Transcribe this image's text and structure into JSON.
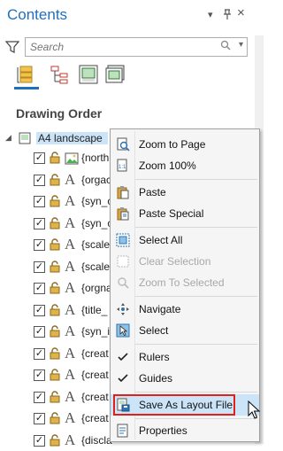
{
  "pane": {
    "title": "Contents",
    "dropdown_glyph": "▾",
    "pin_glyph": "ᵖ",
    "close_glyph": "×"
  },
  "search": {
    "placeholder": "Search",
    "dropdown_glyph": "▾",
    "search_glyph": "⌕"
  },
  "section": {
    "title": "Drawing Order"
  },
  "frame": {
    "expand_glyph": "◢",
    "label": "A4 landscape"
  },
  "layers": [
    {
      "label": "{north",
      "icon": "picture-icon",
      "checked": "✓",
      "glyph": ""
    },
    {
      "label": "{orgac",
      "icon": "text-element-icon",
      "checked": "✓",
      "glyph": "A"
    },
    {
      "label": "{syn_c",
      "icon": "text-element-icon",
      "checked": "✓",
      "glyph": "A"
    },
    {
      "label": "{syn_c",
      "icon": "text-element-icon",
      "checked": "✓",
      "glyph": "A"
    },
    {
      "label": "{scale",
      "icon": "text-element-icon",
      "checked": "✓",
      "glyph": "A"
    },
    {
      "label": "{scale",
      "icon": "text-element-icon",
      "checked": "✓",
      "glyph": "A"
    },
    {
      "label": "{orgna",
      "icon": "text-element-icon",
      "checked": "✓",
      "glyph": "A"
    },
    {
      "label": "{title_",
      "icon": "text-element-icon",
      "checked": "✓",
      "glyph": "A"
    },
    {
      "label": "{syn_i",
      "icon": "text-element-icon",
      "checked": "✓",
      "glyph": "A"
    },
    {
      "label": "{creat",
      "icon": "text-element-icon",
      "checked": "✓",
      "glyph": "A"
    },
    {
      "label": "{creat",
      "icon": "text-element-icon",
      "checked": "✓",
      "glyph": "A"
    },
    {
      "label": "{creat",
      "icon": "text-element-icon",
      "checked": "✓",
      "glyph": "A"
    },
    {
      "label": "{creat",
      "icon": "text-element-icon",
      "checked": "✓",
      "glyph": "A"
    },
    {
      "label": "{discla",
      "icon": "text-element-icon",
      "checked": "✓",
      "glyph": "A"
    }
  ],
  "context_menu": {
    "items": [
      {
        "label": "Zoom to Page",
        "icon": "zoom-page-icon",
        "enabled": true
      },
      {
        "label": "Zoom 100%",
        "icon": "zoom-100-icon",
        "enabled": true
      },
      {
        "label": "Paste",
        "icon": "paste-icon",
        "enabled": true
      },
      {
        "label": "Paste Special",
        "icon": "paste-special-icon",
        "enabled": true
      },
      {
        "label": "Select All",
        "icon": "select-all-icon",
        "enabled": true
      },
      {
        "label": "Clear Selection",
        "icon": "clear-selection-icon",
        "enabled": false
      },
      {
        "label": "Zoom To Selected",
        "icon": "zoom-selected-icon",
        "enabled": false
      },
      {
        "label": "Navigate",
        "icon": "navigate-icon",
        "enabled": true
      },
      {
        "label": "Select",
        "icon": "select-arrow-icon",
        "enabled": true
      },
      {
        "label": "Rulers",
        "icon": "check-icon",
        "enabled": true
      },
      {
        "label": "Guides",
        "icon": "check-icon",
        "enabled": true
      },
      {
        "label": "Save As Layout File",
        "icon": "save-layout-icon",
        "enabled": true
      },
      {
        "label": "Properties",
        "icon": "properties-icon",
        "enabled": true
      }
    ]
  },
  "colors": {
    "accent": "#1f6fbf",
    "highlight": "#cce4f7",
    "red_box": "#e0201b"
  }
}
